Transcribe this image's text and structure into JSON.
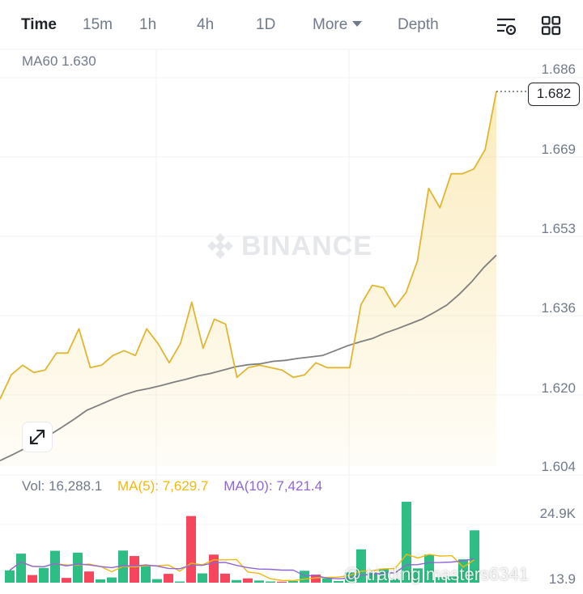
{
  "toolbar": {
    "tabs": [
      {
        "label": "Time",
        "active": true
      },
      {
        "label": "15m",
        "active": false
      },
      {
        "label": "1h",
        "active": false
      },
      {
        "label": "4h",
        "active": false
      },
      {
        "label": "1D",
        "active": false
      },
      {
        "label": "More",
        "active": false
      },
      {
        "label": "Depth",
        "active": false
      }
    ],
    "icons": [
      "chart-settings-icon",
      "layout-grid-icon"
    ]
  },
  "chart": {
    "ma60_label": "MA60 1.630",
    "watermark": "BINANCE",
    "price_ticks": [
      "1.686",
      "1.669",
      "1.653",
      "1.636",
      "1.620",
      "1.604"
    ],
    "last_price": "1.682",
    "colors": {
      "price_line": "#e0b631",
      "ma60_line": "#7f7f7f",
      "up": "#2ebd85",
      "down": "#f6465d",
      "ma5": "#f0b90b",
      "ma10": "#8f66d6"
    }
  },
  "volume": {
    "vol_text": "Vol: 16,288.1",
    "ma5_text": "MA(5): 7,629.7",
    "ma10_text": "MA(10): 7,421.4",
    "ticks": [
      "24.9K",
      "13.9"
    ]
  },
  "credit": "@ trading masters6341",
  "chart_data": {
    "type": "line",
    "y_range": [
      1.604,
      1.686
    ],
    "price_series": [
      1.618,
      1.623,
      1.625,
      1.6235,
      1.624,
      1.6275,
      1.6275,
      1.6325,
      1.6245,
      1.625,
      1.627,
      1.628,
      1.627,
      1.6325,
      1.6295,
      1.6255,
      1.6295,
      1.638,
      1.6285,
      1.6345,
      1.6335,
      1.6225,
      1.6245,
      1.625,
      1.6245,
      1.624,
      1.6225,
      1.623,
      1.6255,
      1.6245,
      1.6245,
      1.6245,
      1.6375,
      1.6415,
      1.641,
      1.637,
      1.64,
      1.6465,
      1.6615,
      1.6575,
      1.6645,
      1.6645,
      1.6655,
      1.6695,
      1.6815
    ],
    "ma60_series": [
      1.6053,
      1.6065,
      1.6078,
      1.609,
      1.6106,
      1.6122,
      1.6139,
      1.6157,
      1.6168,
      1.6179,
      1.6189,
      1.6197,
      1.6202,
      1.6208,
      1.6215,
      1.6221,
      1.6228,
      1.6233,
      1.624,
      1.6247,
      1.6251,
      1.6253,
      1.6258,
      1.626,
      1.6264,
      1.6267,
      1.627,
      1.628,
      1.629,
      1.6298,
      1.6305,
      1.6316,
      1.6325,
      1.6335,
      1.6345,
      1.6359,
      1.6374,
      1.6396,
      1.6422,
      1.6452,
      1.6477
    ],
    "volume_series": [
      {
        "v": 5200,
        "up": true
      },
      {
        "v": 12200,
        "up": true
      },
      {
        "v": 3200,
        "up": false
      },
      {
        "v": 6200,
        "up": true
      },
      {
        "v": 13400,
        "up": true
      },
      {
        "v": 2000,
        "up": false
      },
      {
        "v": 12600,
        "up": true
      },
      {
        "v": 4700,
        "up": false
      },
      {
        "v": 1400,
        "up": true
      },
      {
        "v": 2200,
        "up": true
      },
      {
        "v": 13500,
        "up": true
      },
      {
        "v": 11200,
        "up": false
      },
      {
        "v": 7200,
        "up": true
      },
      {
        "v": 1500,
        "up": true
      },
      {
        "v": 3700,
        "up": false
      },
      {
        "v": 500,
        "up": true
      },
      {
        "v": 28000,
        "up": false
      },
      {
        "v": 3900,
        "up": true
      },
      {
        "v": 11800,
        "up": false
      },
      {
        "v": 3800,
        "up": false
      },
      {
        "v": 1100,
        "up": true
      },
      {
        "v": 1800,
        "up": false
      },
      {
        "v": 900,
        "up": true
      },
      {
        "v": 500,
        "up": true
      },
      {
        "v": 400,
        "up": false
      },
      {
        "v": 700,
        "up": true
      },
      {
        "v": 5000,
        "up": true
      },
      {
        "v": 3400,
        "up": false
      },
      {
        "v": 1800,
        "up": true
      },
      {
        "v": 700,
        "up": true
      },
      {
        "v": 4300,
        "up": true
      },
      {
        "v": 14000,
        "up": true
      },
      {
        "v": 4200,
        "up": true
      },
      {
        "v": 5900,
        "up": true
      },
      {
        "v": 1600,
        "up": true
      },
      {
        "v": 34000,
        "up": true
      },
      {
        "v": 6000,
        "up": true
      },
      {
        "v": 11800,
        "up": true
      },
      {
        "v": 2300,
        "up": true
      },
      {
        "v": 2600,
        "up": true
      },
      {
        "v": 9800,
        "up": true
      },
      {
        "v": 22000,
        "up": true
      }
    ]
  }
}
